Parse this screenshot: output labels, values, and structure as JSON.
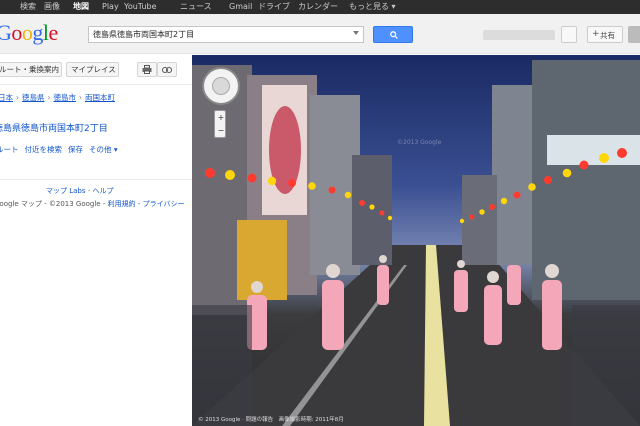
{
  "gbar": {
    "items": [
      "検索",
      "画像",
      "地図",
      "Play",
      "YouTube",
      "ニュース",
      "Gmail",
      "ドライブ",
      "カレンダー",
      "もっと見る ▾"
    ],
    "active_index": 2
  },
  "header": {
    "logo": "Google",
    "search_value": "徳島県徳島市両国本町2丁目",
    "share_label": "共有"
  },
  "panel": {
    "route_button": "ルート・乗換案内",
    "myplaces_button": "マイプレイス",
    "breadcrumbs": [
      "日本",
      "徳島県",
      "徳島市",
      "両国本町"
    ],
    "title": "徳島県徳島市両国本町2丁目",
    "actions": [
      "ルート",
      "付近を検索",
      "保存",
      "その他 ▾"
    ],
    "footer_links": [
      "マップ Labs",
      "ヘルプ"
    ],
    "copyright": "Google マップ - ©2013 Google - ",
    "footer_links2": [
      "利用規約",
      "プライバシー"
    ]
  },
  "streetview": {
    "watermark": "©2013 Google",
    "copyright": "© 2013 Google · 問題の報告　画像撮影時期: 2011年8月",
    "sky_color": "#1a2a63",
    "lantern_colors": [
      "#ff3b30",
      "#ffd60a"
    ]
  }
}
